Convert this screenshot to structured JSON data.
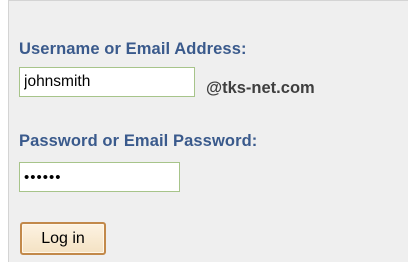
{
  "form": {
    "username_label": "Username or Email Address:",
    "username_value": "johnsmith",
    "domain_suffix": "@tks-net.com",
    "password_label": "Password or Email Password:",
    "password_value": "••••••",
    "login_button_label": "Log in"
  },
  "colors": {
    "label_text": "#3a5a8c",
    "field_border": "#a7c48a",
    "button_border": "#c2894a",
    "panel_background": "#efefef"
  }
}
